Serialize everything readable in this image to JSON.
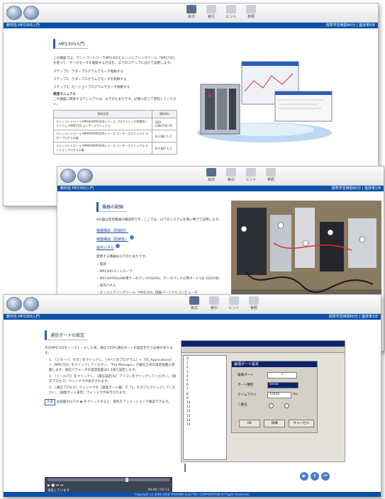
{
  "toolbar": {
    "nav": [
      "戻る",
      "進む"
    ],
    "icons": [
      "目次",
      "索引",
      "ヒント",
      "参照"
    ]
  },
  "window1": {
    "breadcrumb": "教材名:MP2300入門",
    "right_status": "標準学習時間40分 | 進捗率6/8",
    "title": "MP2300入門",
    "intro": "この講座では、マシンコントローラMP2300とエンジニアリングツール「MPE720」を使って、サーボモータを駆動する方法を、以下のステップに分けて説明します。",
    "steps": [
      "ステップ1：ラダープログラムでモータ駆動する",
      "ステップ2：ラダープログラムでモータを制御する",
      "ステップ3：モーションプログラムでモータ制御する"
    ],
    "manual_heading": "関連マニュアル",
    "manual_text": "この講座に関係するマニュアルは、以下のとおりです。必要に応じて参照してください。",
    "table": {
      "headers": [
        "資料名称",
        "資料No."
      ],
      "rows": [
        [
          "マシンコントローラ MP900/MP2000シリーズ プログラミング装置用ソフトウェアMPE720 ユーザーズマニュアル",
          "SIEP C880700 05"
        ],
        [
          "マシンコントローラ MP900/MP2000シリーズ ユーザーズマニュアル ラダープログラム編",
          "SI-C887-1.2"
        ],
        [
          "マシンコントローラ MP900/MP2000シリーズ ユーザーズマニュアル モーションプログラム編",
          "SI-C887-1.3"
        ]
      ]
    }
  },
  "window2": {
    "breadcrumb": "教材名:MP2300入門",
    "right_status": "標準学習時間40分 | 進捗率1/8",
    "title": "機器の配線",
    "intro": "8の図は実習機器の構成例です。ここでは、以下のシステムを例に挙げて説明します。",
    "links": [
      "機器構成（配線前）",
      "機器構成（配線後）",
      "操作パネル"
    ],
    "list_heading": "使用する機器は以下のとおりです。",
    "items": [
      "・電源",
      "・MP2300コントローラ",
      "・MECHATROLINK用サーボパック(SGDS)、サーボパック(Σ用ボード1台 SGDH他)",
      "・操作パネル",
      "・エンジニアリングツール「MPE720」搭載パーソナルコンピュータ"
    ]
  },
  "window3": {
    "breadcrumb": "教材名:MP2300入門",
    "right_status": "標準学習時間60分 | 進捗率3/8",
    "title": "通信ポートの設定",
    "intro": "次のMPE720をインストールした後、通信でのPC通信ポートの設定を行う必要があります。",
    "steps": [
      "1. ［スタート］ボタンをクリックし、［すべてのプログラム］→［YE_Applications］→［MPE720］をクリックしてください。「File Manager」が通信方式の設定画面に移動します。通信パラメータの設定画面は1.2通り設定します。",
      "2. ［ツール(T)］をクリックし、［通信設定(S)］アイコンをクリックしてください。［通信プロセス］ウィンドウが表示されます。",
      "3. ［通信プロセス］ウィンドウの［論理ポート欄］で「1」をダブルクリックしてください。［論理ポート設定］ウィンドウが表示されます。"
    ],
    "note_badge": "注意",
    "note": "右画面の以下の ▶ をクリックすると、操作をアニメーションで確認できます。",
    "dialog": {
      "title": "論理ポート設定",
      "fields": [
        {
          "label": "論理ポート",
          "value": "1"
        },
        {
          "label": "ポート種別",
          "value": "Serial"
        },
        {
          "label": "タイムアウト",
          "value": "10000",
          "unit": "ms"
        },
        {
          "label": "二重化",
          "value": ""
        }
      ],
      "buttons": [
        "OK",
        "詳細",
        "キャンセル"
      ]
    },
    "list_numbers": [
      "0",
      "1",
      "2",
      "3",
      "4",
      "5",
      "6",
      "7",
      "8",
      "9",
      "10",
      "11",
      "12",
      "13",
      "14",
      "15"
    ],
    "player_status": "再生しています",
    "player_time": "00:46 / 02:11",
    "footer": "Copyright (c) 2004-2008 YASKAWA ELECTRIC CORPORATION All Rights Reserved."
  }
}
